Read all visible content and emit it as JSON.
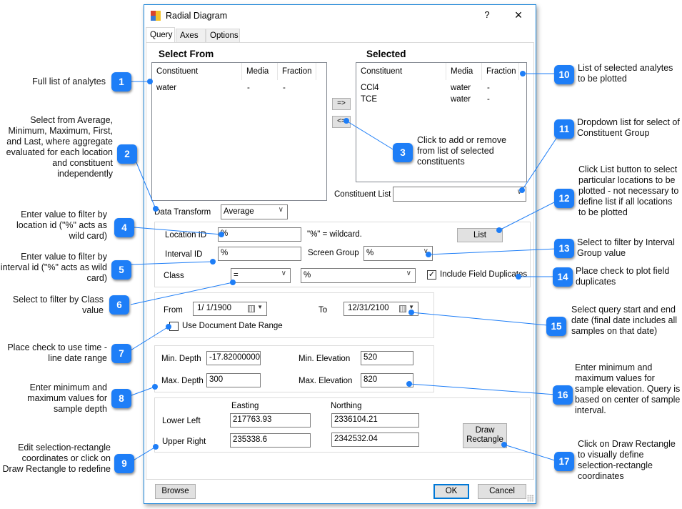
{
  "window": {
    "title": "Radial Diagram",
    "help_label": "?",
    "close_label": "×"
  },
  "tabs": [
    {
      "label": "Query",
      "active": true
    },
    {
      "label": "Axes",
      "active": false
    },
    {
      "label": "Options",
      "active": false
    }
  ],
  "select_from": {
    "heading": "Select From",
    "columns": [
      "Constituent",
      "Media",
      "Fraction"
    ],
    "rows": [
      [
        "water",
        "-",
        "-"
      ]
    ]
  },
  "selected": {
    "heading": "Selected",
    "columns": [
      "Constituent",
      "Media",
      "Fraction"
    ],
    "rows": [
      [
        "CCl4",
        "water",
        "-"
      ],
      [
        "TCE",
        "water",
        "-"
      ]
    ]
  },
  "transfer": {
    "add_label": "=>",
    "remove_label": "<="
  },
  "constituent_list": {
    "label": "Constituent List",
    "value": ""
  },
  "data_transform": {
    "label": "Data Transform",
    "value": "Average"
  },
  "filters": {
    "location_id_label": "Location ID",
    "location_id_value": "%",
    "wildcard_hint": "\"%\" = wildcard.",
    "list_button": "List",
    "interval_id_label": "Interval ID",
    "interval_id_value": "%",
    "screen_group_label": "Screen Group",
    "screen_group_value": "%",
    "class_label": "Class",
    "class_operator": "=",
    "class_value": "%",
    "include_field_duplicates_label": "Include Field Duplicates",
    "include_field_duplicates_checked": true
  },
  "dates": {
    "from_label": "From",
    "from_value": "1/ 1/1900",
    "to_label": "To",
    "to_value": "12/31/2100",
    "use_doc_range_label": "Use Document Date Range",
    "use_doc_range_checked": false
  },
  "depth": {
    "min_depth_label": "Min. Depth",
    "min_depth_value": "-17.82000000(",
    "max_depth_label": "Max. Depth",
    "max_depth_value": "300",
    "min_elev_label": "Min. Elevation",
    "min_elev_value": "520",
    "max_elev_label": "Max. Elevation",
    "max_elev_value": "820"
  },
  "rectangle": {
    "easting_header": "Easting",
    "northing_header": "Northing",
    "lower_left_label": "Lower Left",
    "lower_left_easting": "217763.93",
    "lower_left_northing": "2336104.21",
    "upper_right_label": "Upper Right",
    "upper_right_easting": "235338.6",
    "upper_right_northing": "2342532.04",
    "draw_button_line1": "Draw",
    "draw_button_line2": "Rectangle"
  },
  "footer": {
    "browse_label": "Browse",
    "ok_label": "OK",
    "cancel_label": "Cancel"
  },
  "annotations": {
    "accent_color": "#1e7ef7",
    "items": [
      {
        "num": "1",
        "text": "Full list of analytes"
      },
      {
        "num": "2",
        "text": "Select from Average, Minimum, Maximum, First, and Last, where aggregate evaluated for each location and constituent independently"
      },
      {
        "num": "3",
        "text": "Click to add or remove from list of selected constituents"
      },
      {
        "num": "4",
        "text": "Enter value to filter by location id (\"%\" acts as wild card)"
      },
      {
        "num": "5",
        "text": "Enter value to filter by interval id (\"%\" acts as wild card)"
      },
      {
        "num": "6",
        "text": "Select to filter by Class value"
      },
      {
        "num": "7",
        "text": "Place check to use time -line date range"
      },
      {
        "num": "8",
        "text": "Enter minimum and maximum values for sample depth"
      },
      {
        "num": "9",
        "text": "Edit selection-rectangle coordinates or click on Draw Rectangle to redefine"
      },
      {
        "num": "10",
        "text": "List of selected analytes to be plotted"
      },
      {
        "num": "11",
        "text": "Dropdown list for select of Constituent Group"
      },
      {
        "num": "12",
        "text": "Click List button to select particular locations to be plotted - not necessary to define list if all locations to be plotted"
      },
      {
        "num": "13",
        "text": "Select to filter by Interval Group value"
      },
      {
        "num": "14",
        "text": "Place check to plot field duplicates"
      },
      {
        "num": "15",
        "text": "Select query start and end date (final date includes all samples on that date)"
      },
      {
        "num": "16",
        "text": "Enter minimum and maximum values for sample elevation. Query is based on center of sample interval."
      },
      {
        "num": "17",
        "text": "Click on Draw Rectangle to visually define selection-rectangle coordinates"
      }
    ]
  }
}
